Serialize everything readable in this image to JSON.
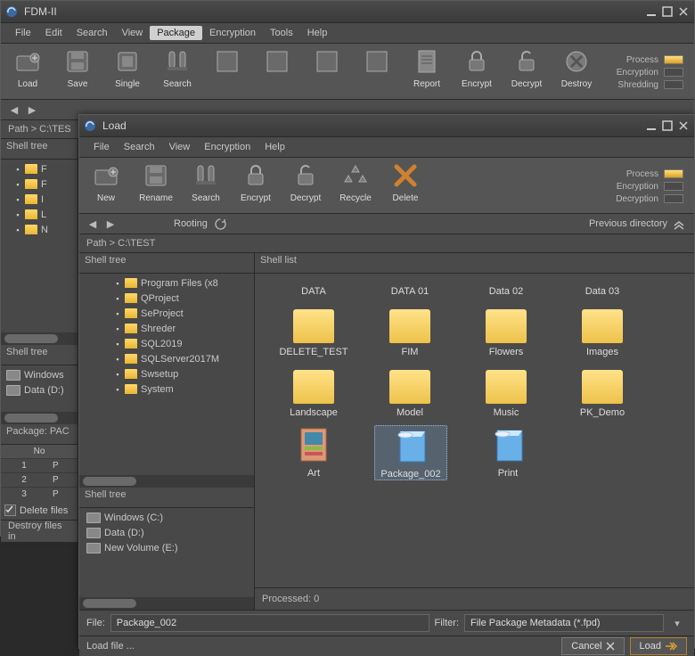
{
  "main": {
    "title": "FDM-II",
    "menu": [
      "File",
      "Edit",
      "Search",
      "View",
      "Package",
      "Encryption",
      "Tools",
      "Help"
    ],
    "menu_active": "Package",
    "tools": [
      "Load",
      "Save",
      "Single",
      "Search",
      "",
      "",
      "",
      "",
      "Report",
      "Encrypt",
      "Decrypt",
      "Destroy"
    ],
    "status": [
      {
        "label": "Process",
        "on": true
      },
      {
        "label": "Encryption",
        "on": false
      },
      {
        "label": "Shredding",
        "on": false
      }
    ],
    "path_label": "Path > C:\\TES",
    "shell_tree1_label": "Shell tree",
    "shell_tree1": [
      "F",
      "F",
      "I",
      "L",
      "N"
    ],
    "shell_tree2_label": "Shell tree",
    "shell_tree2": [
      {
        "label": "Windows",
        "kind": "drive"
      },
      {
        "label": "Data (D:)",
        "kind": "drive"
      }
    ],
    "package_label": "Package: PAC",
    "table_header": "No",
    "table_rows": [
      {
        "no": "1",
        "v": "P"
      },
      {
        "no": "2",
        "v": "P"
      },
      {
        "no": "3",
        "v": "P"
      }
    ],
    "delete_files": "Delete files",
    "destroy_files": "Destroy files in"
  },
  "dialog": {
    "title": "Load",
    "menu": [
      "File",
      "Search",
      "View",
      "Encryption",
      "Help"
    ],
    "tools": [
      "New",
      "Rename",
      "Search",
      "Encrypt",
      "Decrypt",
      "Recycle",
      "Delete"
    ],
    "status": [
      {
        "label": "Process",
        "on": true
      },
      {
        "label": "Encryption",
        "on": false
      },
      {
        "label": "Decryption",
        "on": false
      }
    ],
    "nav_rooting": "Rooting",
    "nav_prev": "Previous directory",
    "path_label": "Path > C:\\TEST",
    "tree1_label": "Shell tree",
    "tree1": [
      "Program Files (x8",
      "QProject",
      "SeProject",
      "Shreder",
      "SQL2019",
      "SQLServer2017M",
      "Swsetup",
      "System"
    ],
    "tree2_label": "Shell tree",
    "tree2": [
      {
        "label": "Windows (C:)",
        "kind": "drive"
      },
      {
        "label": "Data (D:)",
        "kind": "drive"
      },
      {
        "label": "New Volume (E:)",
        "kind": "drive"
      }
    ],
    "list_label": "Shell list",
    "row1": [
      "DATA",
      "DATA 01",
      "Data 02",
      "Data 03"
    ],
    "row2": [
      "DELETE_TEST",
      "FIM",
      "Flowers",
      "Images"
    ],
    "row3": [
      "Landscape",
      "Model",
      "Music",
      "PK_Demo"
    ],
    "row4": [
      "Art",
      "Package_002",
      "Print"
    ],
    "processed": "Processed: 0",
    "file_label": "File:",
    "file_value": "Package_002",
    "filter_label": "Filter:",
    "filter_value": "File Package Metadata (*.fpd)",
    "status_text": "Load file ...",
    "btn_cancel": "Cancel",
    "btn_load": "Load"
  }
}
